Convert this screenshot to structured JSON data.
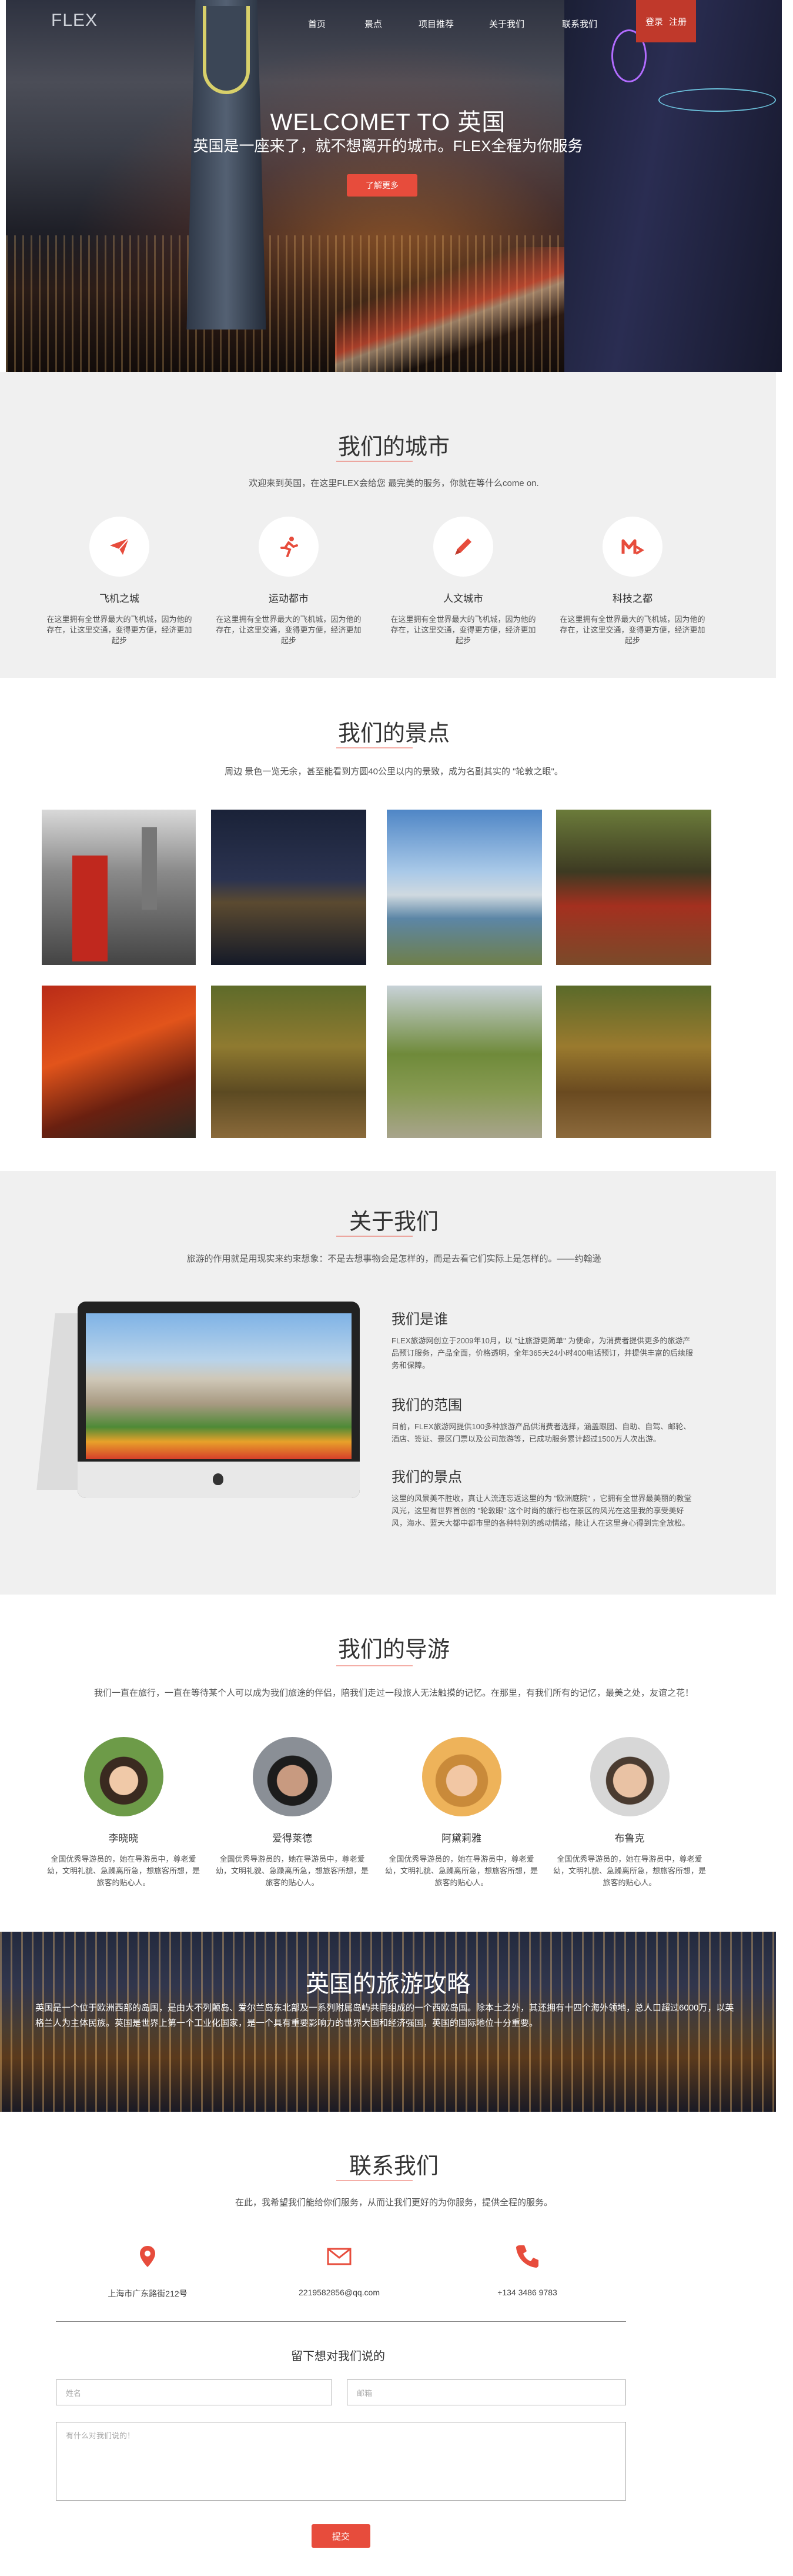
{
  "header": {
    "logo": "FLEX",
    "nav": [
      "首页",
      "景点",
      "项目推荐",
      "关于我们",
      "联系我们"
    ],
    "login": "登录",
    "register": "注册"
  },
  "hero": {
    "title": "WELCOMET TO 英国",
    "subtitle": "英国是一座来了，就不想离开的城市。FLEX全程为你服务",
    "button": "了解更多"
  },
  "cities": {
    "title": "我们的城市",
    "subtitle": "欢迎来到英国，在这里FLEX会给您 最完美的服务，你就在等什么come on.",
    "items": [
      {
        "name": "飞机之城",
        "icon": "plane-icon",
        "text": "在这里拥有全世界最大的飞机城，因为他的存在，让这里交通，变得更方便，经济更加起步"
      },
      {
        "name": "运动都市",
        "icon": "runner-icon",
        "text": "在这里拥有全世界最大的飞机城，因为他的存在，让这里交通，变得更方便，经济更加起步"
      },
      {
        "name": "人文城市",
        "icon": "pencil-icon",
        "text": "在这里拥有全世界最大的飞机城，因为他的存在，让这里交通，变得更方便，经济更加起步"
      },
      {
        "name": "科技之都",
        "icon": "tech-icon",
        "text": "在这里拥有全世界最大的飞机城，因为他的存在，让这里交通，变得更方便，经济更加起步"
      }
    ]
  },
  "attractions": {
    "title": "我们的景点",
    "subtitle": "周边 景色一览无余，甚至能看到方圆40公里以内的景致，成为名副其实的 \"轮敦之眼\"。"
  },
  "about": {
    "title": "关于我们",
    "subtitle": "旅游的作用就是用现实来约束想象：不是去想事物会是怎样的，而是去看它们实际上是怎样的。——约翰逊",
    "blocks": [
      {
        "heading": "我们是谁",
        "text": "FLEX旅游网创立于2009年10月，以 \"让旅游更简单\" 为使命，为消费者提供更多的旅游产品预订服务，产品全面，价格透明，全年365天24小时400电话预订，并提供丰富的后续服务和保障。"
      },
      {
        "heading": "我们的范围",
        "text": "目前，FLEX旅游网提供100多种旅游产品供消费者选择，涵盖跟团、自助、自驾、邮轮、酒店、签证、景区门票以及公司旅游等，已成功服务累计超过1500万人次出游。"
      },
      {
        "heading": "我们的景点",
        "text": "这里的风景美不胜收，真让人流连忘返这里的为 \"欧洲庭院\" ，它拥有全世界最美丽的教堂风光，这里有世界首创的 \"轮敦眼\" 这个时尚的旅行也在景区的风光在这里我的享受美好风，海水、蓝天大都中都市里的各种特别的感动情绪，能让人在这里身心得到完全放松。"
      }
    ]
  },
  "guides": {
    "title": "我们的导游",
    "subtitle": "我们一直在旅行，一直在等待某个人可以成为我们旅途的伴侣，陪我们走过一段旅人无法触摸的记忆。在那里，有我们所有的记忆，最美之处，友谊之花！",
    "people": [
      {
        "name": "李晓晓",
        "text": "全国优秀导游员的，她在导游员中，尊老爱幼，文明礼貌、急躁离所急，想旅客所想，是旅客的贴心人。"
      },
      {
        "name": "爱得莱德",
        "text": "全国优秀导游员的，她在导游员中，尊老爱幼，文明礼貌、急躁离所急，想旅客所想，是旅客的贴心人。"
      },
      {
        "name": "阿黛莉雅",
        "text": "全国优秀导游员的，她在导游员中，尊老爱幼，文明礼貌、急躁离所急，想旅客所想，是旅客的贴心人。"
      },
      {
        "name": "布鲁克",
        "text": "全国优秀导游员的，她在导游员中，尊老爱幼，文明礼貌、急躁离所急，想旅客所想，是旅客的贴心人。"
      }
    ]
  },
  "guide_banner": {
    "title": "英国的旅游攻略",
    "text": "英国是一个位于欧洲西部的岛国，是由大不列颠岛、爱尔兰岛东北部及一系列附属岛屿共同组成的一个西欧岛国。除本土之外，其还拥有十四个海外领地，总人口超过6000万，以英格兰人为主体民族。英国是世界上第一个工业化国家，是一个具有重要影响力的世界大国和经济强国，英国的国际地位十分重要。"
  },
  "contact": {
    "title": "联系我们",
    "subtitle": "在此，我希望我们能给你们服务，从而让我们更好的为你服务，提供全程的服务。",
    "address": "上海市广东路街212号",
    "email": "2219582856@qq.com",
    "phone": "+134 3486 9783",
    "form_title": "留下想对我们说的",
    "name_placeholder": "姓名",
    "email_placeholder": "邮箱",
    "message_placeholder": "有什么对我们说的！",
    "submit": "提交"
  },
  "colors": {
    "accent": "#e74c3c"
  }
}
